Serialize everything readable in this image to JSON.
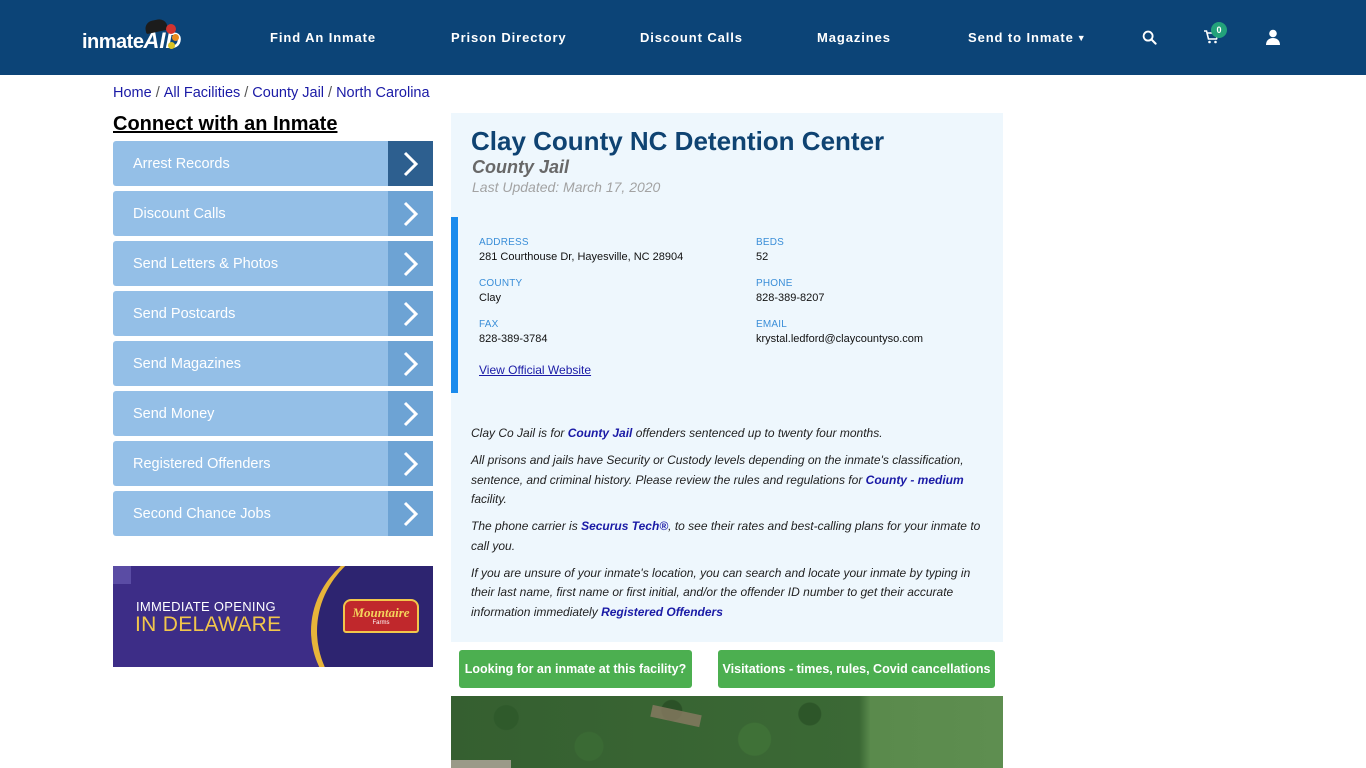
{
  "header": {
    "logo_text_1": "inmate",
    "logo_text_2": "AID",
    "nav": [
      {
        "label": "Find An Inmate"
      },
      {
        "label": "Prison Directory"
      },
      {
        "label": "Discount Calls"
      },
      {
        "label": "Magazines"
      },
      {
        "label": "Send to Inmate",
        "has_dropdown": true
      }
    ],
    "icons": {
      "search": "search-icon",
      "cart": "cart-icon",
      "user": "user-icon"
    },
    "cart_count": "0",
    "colors": {
      "bar": "#0c4477",
      "badge": "#23a27a"
    }
  },
  "breadcrumb": [
    {
      "label": "Home"
    },
    {
      "label": "All Facilities"
    },
    {
      "label": "County Jail"
    },
    {
      "label": "North Carolina"
    }
  ],
  "sidebar": {
    "title": "Connect with an Inmate",
    "items": [
      {
        "label": "Arrest Records"
      },
      {
        "label": "Discount Calls"
      },
      {
        "label": "Send Letters & Photos"
      },
      {
        "label": "Send Postcards"
      },
      {
        "label": "Send Magazines"
      },
      {
        "label": "Send Money"
      },
      {
        "label": "Registered Offenders"
      },
      {
        "label": "Second Chance Jobs"
      }
    ],
    "ad": {
      "line1": "IMMEDIATE OPENING",
      "line2": "IN DELAWARE",
      "brand": "Mountaire",
      "brand_tagline": "Farms"
    }
  },
  "facility": {
    "name": "Clay County NC Detention Center",
    "type": "County Jail",
    "last_updated": "Last Updated: March 17, 2020",
    "fields": {
      "address": {
        "label": "ADDRESS",
        "value": "281 Courthouse Dr, Hayesville, NC 28904"
      },
      "beds": {
        "label": "BEDS",
        "value": "52"
      },
      "county": {
        "label": "COUNTY",
        "value": "Clay"
      },
      "phone": {
        "label": "PHONE",
        "value": "828-389-8207"
      },
      "fax": {
        "label": "FAX",
        "value": "828-389-3784"
      },
      "email": {
        "label": "EMAIL",
        "value": "krystal.ledford@claycountyso.com"
      }
    },
    "website_link": "View Official Website",
    "description": {
      "p1_a": "Clay Co Jail is for ",
      "p1_link": "County Jail",
      "p1_b": " offenders sentenced up to twenty four months.",
      "p2_a": "All prisons and jails have Security or Custody levels depending on the inmate's classification, sentence, and criminal history. Please review the rules and regulations for ",
      "p2_link": "County - medium",
      "p2_b": " facility.",
      "p3_a": "The phone carrier is ",
      "p3_link": "Securus Tech®",
      "p3_b": ", to see their rates and best-calling plans for your inmate to call you.",
      "p4_a": "If you are unsure of your inmate's location, you can search and locate your inmate by typing in their last name, first name or first initial, and/or the offender ID number to get their accurate information immediately ",
      "p4_link": "Registered Offenders"
    }
  },
  "actions": {
    "find_inmate": "Looking for an inmate at this facility?",
    "visitations": "Visitations - times, rules, Covid cancellations"
  }
}
